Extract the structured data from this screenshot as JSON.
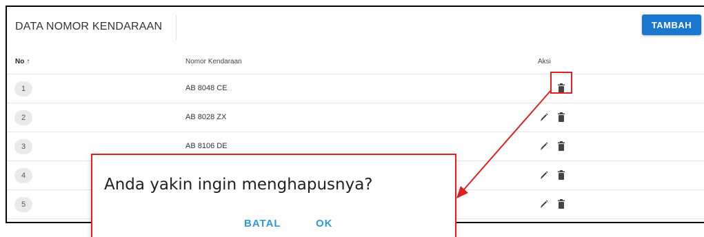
{
  "header": {
    "title": "DATA NOMOR KENDARAAN",
    "add_button_label": "TAMBAH"
  },
  "table": {
    "columns": {
      "no": "No",
      "sort_arrow": "↑",
      "plate": "Nomor Kendaraan",
      "action": "Aksi"
    },
    "rows": [
      {
        "no": "1",
        "plate": "AB 8048 CE"
      },
      {
        "no": "2",
        "plate": "AB 8028 ZX"
      },
      {
        "no": "3",
        "plate": "AB 8106 DE"
      },
      {
        "no": "4",
        "plate": ""
      },
      {
        "no": "5",
        "plate": ""
      }
    ],
    "row_icons": [
      "pencil-icon",
      "trash-icon"
    ]
  },
  "dialog": {
    "message": "Anda yakin ingin menghapusnya?",
    "cancel_label": "BATAL",
    "ok_label": "OK"
  },
  "colors": {
    "primary_button": "#1977cf",
    "dialog_action_text": "#2a9ad8",
    "annotation_red": "#e02020"
  }
}
